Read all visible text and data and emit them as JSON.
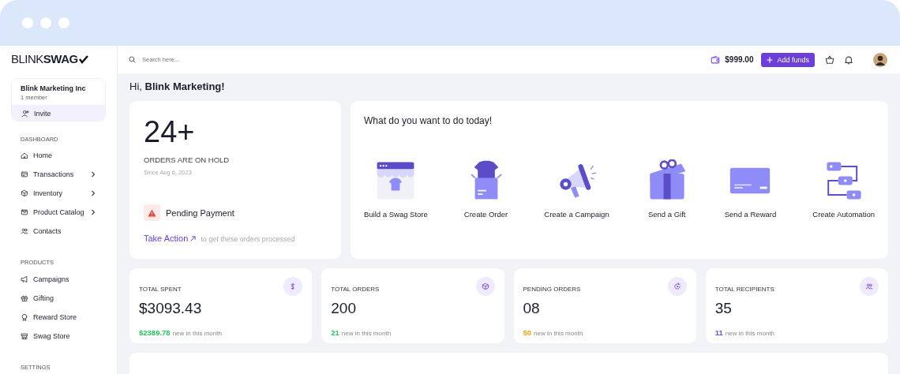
{
  "logo": "BLINK**SWAG**",
  "org": {
    "name": "Blink Marketing Inc",
    "members": "1 member",
    "invite": "Invite"
  },
  "sidebar": [
    {
      "heading": "DASHBOARD",
      "items": [
        {
          "label": "Home",
          "kind": "home",
          "expandable": false
        },
        {
          "label": "Transactions",
          "kind": "card",
          "expandable": true
        },
        {
          "label": "Inventory",
          "kind": "box",
          "expandable": true
        },
        {
          "label": "Product Catalog",
          "kind": "catalog",
          "expandable": true
        },
        {
          "label": "Contacts",
          "kind": "people",
          "expandable": false
        }
      ]
    },
    {
      "heading": "PRODUCTS",
      "items": [
        {
          "label": "Campaigns",
          "kind": "megaphone",
          "expandable": false
        },
        {
          "label": "Gifting",
          "kind": "gift",
          "expandable": false
        },
        {
          "label": "Reward Store",
          "kind": "medal",
          "expandable": false
        },
        {
          "label": "Swag Store",
          "kind": "store",
          "expandable": false
        }
      ]
    },
    {
      "heading": "SETTINGS"
    }
  ],
  "search": {
    "placeholder": "Search here..."
  },
  "balance": "$999.00",
  "add_funds": "Add funds",
  "greeting": "Hi, **Blink Marketing!**",
  "hold": {
    "count": "24+",
    "label": "ORDERS ARE ON HOLD",
    "since": "Since Aug 6, 2023",
    "alert": "Pending Payment",
    "action": "Take Action",
    "action_note": "to get these orders processed"
  },
  "actions": {
    "title": "What do you want to do today!",
    "items": [
      {
        "kind": "store",
        "label": "Build a Swag Store"
      },
      {
        "kind": "order",
        "label": "Create Order"
      },
      {
        "kind": "campaign",
        "label": "Create a Campaign"
      },
      {
        "kind": "gift",
        "label": "Send a Gift"
      },
      {
        "kind": "reward",
        "label": "Send a Reward"
      },
      {
        "kind": "automation",
        "label": "Create Automation"
      }
    ]
  },
  "stats": [
    {
      "title": "TOTAL SPENT",
      "value": "$3093.43",
      "kind": "dollar",
      "delta": "$2389.78",
      "note": "new in this month",
      "color": "#22c55e"
    },
    {
      "title": "TOTAL ORDERS",
      "value": "200",
      "kind": "box",
      "delta": "21",
      "note": "new in this month",
      "color": "#22c55e"
    },
    {
      "title": "PENDING ORDERS",
      "value": "08",
      "kind": "refresh",
      "delta": "50",
      "note": "new in this month",
      "color": "#f59e0b"
    },
    {
      "title": "TOTAL RECIPIENTS",
      "value": "35",
      "kind": "people",
      "delta": "11",
      "note": "new in this month",
      "color": "#6d4fd6"
    }
  ]
}
